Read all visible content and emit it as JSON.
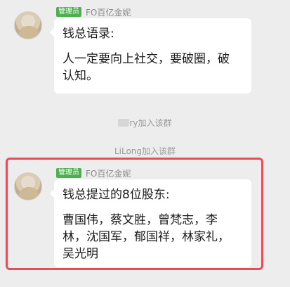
{
  "messages": [
    {
      "badge": "管理员",
      "sender": "FO百亿金妮",
      "title": "钱总语录:",
      "body": "人一定要向上社交，要破圈，破\n认知。"
    },
    {
      "badge": "管理员",
      "sender": "FO百亿金妮",
      "title": "钱总提过的8位股东:",
      "body": "曹国伟，蔡文胜，曾梵志，李\n林，沈国军，郁国祥，林家礼，\n吴光明"
    }
  ],
  "system_notices": [
    {
      "prefix_hidden": true,
      "text": "ry加入该群"
    },
    {
      "text": "LiLong加入该群"
    }
  ],
  "colors": {
    "background": "#ededed",
    "badge": "#4caf50",
    "highlight": "#e0505a"
  }
}
